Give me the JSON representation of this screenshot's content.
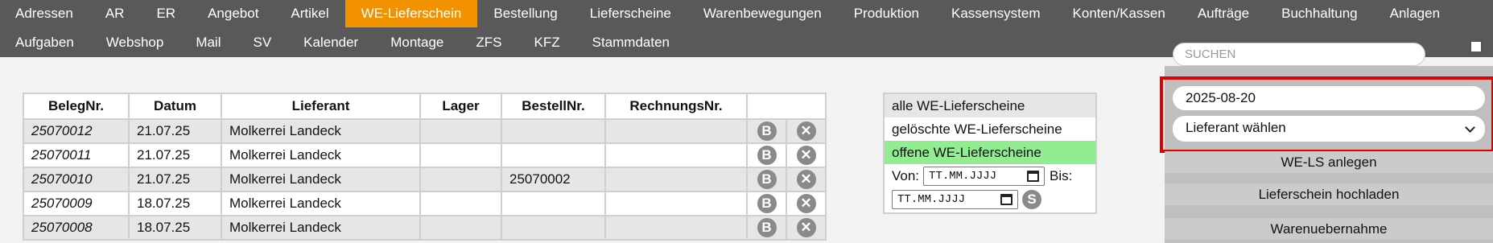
{
  "nav": {
    "row1": [
      "Adressen",
      "AR",
      "ER",
      "Angebot",
      "Artikel",
      "WE-Lieferschein",
      "Bestellung",
      "Lieferscheine",
      "Warenbewegungen",
      "Produktion",
      "Kassensystem",
      "Konten/Kassen",
      "Aufträge",
      "Buchhaltung",
      "Anlagen"
    ],
    "row2": [
      "Aufgaben",
      "Webshop",
      "Mail",
      "SV",
      "Kalender",
      "Montage",
      "ZFS",
      "KFZ",
      "Stammdaten"
    ],
    "active": "WE-Lieferschein",
    "active_color": "#f39200"
  },
  "table": {
    "headers": [
      "BelegNr.",
      "Datum",
      "Lieferant",
      "Lager",
      "BestellNr.",
      "RechnungsNr.",
      ""
    ],
    "rows": [
      {
        "beleg": "25070012",
        "datum": "21.07.25",
        "lieferant": "Molkerrei Landeck",
        "lager": "",
        "bestell": "",
        "rechnung": ""
      },
      {
        "beleg": "25070011",
        "datum": "21.07.25",
        "lieferant": "Molkerrei Landeck",
        "lager": "",
        "bestell": "",
        "rechnung": ""
      },
      {
        "beleg": "25070010",
        "datum": "21.07.25",
        "lieferant": "Molkerrei Landeck",
        "lager": "",
        "bestell": "25070002",
        "rechnung": ""
      },
      {
        "beleg": "25070009",
        "datum": "18.07.25",
        "lieferant": "Molkerrei Landeck",
        "lager": "",
        "bestell": "",
        "rechnung": ""
      },
      {
        "beleg": "25070008",
        "datum": "18.07.25",
        "lieferant": "Molkerrei Landeck",
        "lager": "",
        "bestell": "",
        "rechnung": ""
      }
    ],
    "btn_b": "B",
    "btn_x": "✕"
  },
  "filter": {
    "all": "alle WE-Lieferscheine",
    "deleted": "gelöschte WE-Lieferscheine",
    "open": "offene WE-Lieferscheine",
    "from_label": "Von:",
    "to_label": "Bis:",
    "date_placeholder": "TT.MM.JJJJ",
    "submit": "S",
    "selected_color": "#90ee90"
  },
  "right": {
    "search_placeholder": "SUCHEN",
    "date_value": "2025-08-20",
    "supplier_select": "Lieferant wählen",
    "btn_create": "WE-LS anlegen",
    "btn_upload": "Lieferschein hochladen",
    "btn_takeover": "Warenuebernahme",
    "highlight_color": "#e00000"
  }
}
